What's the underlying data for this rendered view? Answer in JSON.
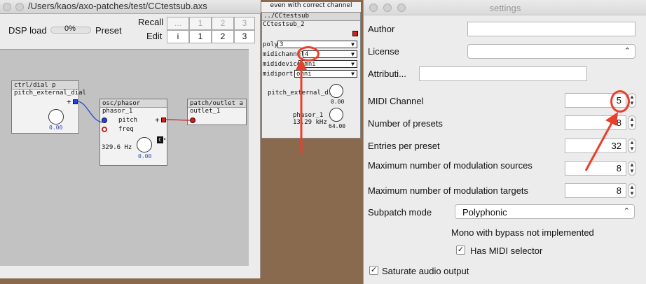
{
  "main_window": {
    "title": "/Users/kaos/axo-patches/test/CCtestsub.axs",
    "dsp_label": "DSP load",
    "dsp_value": "0%",
    "preset_label": "Preset",
    "recall_label": "Recall",
    "edit_label": "Edit",
    "recall_buttons": [
      "...",
      "1",
      "2",
      "3"
    ],
    "edit_buttons": [
      "i",
      "1",
      "2",
      "3"
    ]
  },
  "objects": {
    "dial": {
      "header": "ctrl/dial p",
      "name": "pitch_external_dial",
      "value": "0.00"
    },
    "phasor": {
      "header": "osc/phasor",
      "name": "phasor_1",
      "inlet_pitch": "pitch",
      "inlet_freq": "freq",
      "freq_display": "329.6 Hz",
      "value": "0.00"
    },
    "outlet": {
      "header": "patch/outlet a",
      "name": "outlet_1"
    }
  },
  "sub_window": {
    "top_label": "even with correct channel",
    "header": "../CCtestsub",
    "name": "CCtestsub_2",
    "poly_label": "poly",
    "poly_value": "3",
    "midichannel_label": "midichannel",
    "midichannel_value": "4",
    "mididevice_label": "mididevice",
    "mididevice_value": "omni",
    "midiport_label": "midiport",
    "midiport_value": "omni",
    "dial_label": "pitch_external_dial",
    "dial_value": "0.00",
    "phasor_label": "phasor_1",
    "phasor_freq": "13.29 kHz",
    "phasor_value": "64.00"
  },
  "settings": {
    "title": "settings",
    "author_label": "Author",
    "license_label": "License",
    "attribution_label": "Attributi...",
    "midi_channel_label": "MIDI Channel",
    "midi_channel_value": "5",
    "presets_label": "Number of presets",
    "presets_value": "8",
    "entries_label": "Entries per preset",
    "entries_value": "32",
    "mod_sources_label": "Maximum number of modulation sources",
    "mod_sources_value": "8",
    "mod_targets_label": "Maximum number of modulation targets",
    "mod_targets_value": "8",
    "subpatch_mode_label": "Subpatch mode",
    "subpatch_mode_value": "Polyphonic",
    "mono_note": "Mono with bypass not implemented",
    "has_midi_selector_label": "Has MIDI selector",
    "has_midi_selector_checked": true,
    "saturate_label": "Saturate audio output",
    "saturate_checked": true
  },
  "colors": {
    "annotation": "#e8402b",
    "knob_value": "#3348b8"
  }
}
